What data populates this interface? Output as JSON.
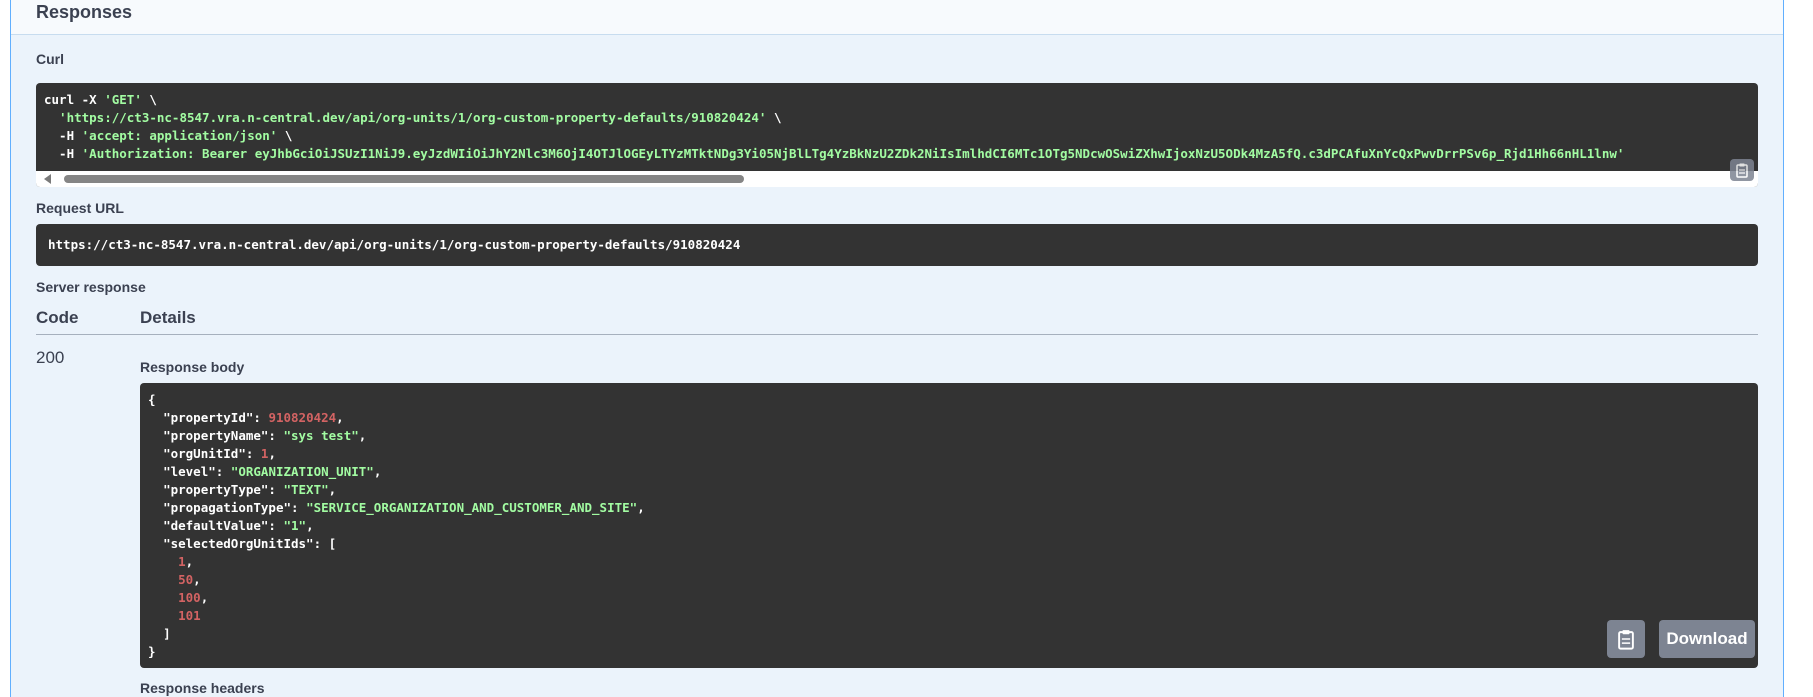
{
  "responses": {
    "title": "Responses",
    "curl_label": "Curl",
    "curl": {
      "l1_cmd": "curl -X ",
      "l1_method": "'GET'",
      "l1_cont": " \\",
      "l2_url": "  'https://ct3-nc-8547.vra.n-central.dev/api/org-units/1/org-custom-property-defaults/910820424'",
      "l2_cont": " \\",
      "l3_flag": "  -H ",
      "l3_val": "'accept: application/json'",
      "l3_cont": " \\",
      "l4_flag": "  -H ",
      "l4_val": "'Authorization: Bearer eyJhbGciOiJSUzI1NiJ9.eyJzdWIiOiJhY2Nlc3M6OjI4OTJlOGEyLTYzMTktNDg3Yi05NjBlLTg4YzBkNzU2ZDk2NiIsImlhdCI6MTc1OTg5NDcwOSwiZXhwIjoxNzU5ODk4MzA5fQ.c3dPCAfuXnYcQxPwvDrrPSv6p_Rjd1Hh66nHL1lnw'"
    },
    "request_url_label": "Request URL",
    "request_url": "https://ct3-nc-8547.vra.n-central.dev/api/org-units/1/org-custom-property-defaults/910820424",
    "server_response_label": "Server response",
    "table": {
      "code_header": "Code",
      "details_header": "Details",
      "code": "200"
    },
    "response_body_label": "Response body",
    "response_headers_label": "Response headers",
    "download_label": "Download",
    "body": {
      "open": "{",
      "k1": "\"propertyId\"",
      "v1": "910820424",
      "k2": "\"propertyName\"",
      "v2": "\"sys test\"",
      "k3": "\"orgUnitId\"",
      "v3": "1",
      "k4": "\"level\"",
      "v4": "\"ORGANIZATION_UNIT\"",
      "k5": "\"propertyType\"",
      "v5": "\"TEXT\"",
      "k6": "\"propagationType\"",
      "v6": "\"SERVICE_ORGANIZATION_AND_CUSTOMER_AND_SITE\"",
      "k7": "\"defaultValue\"",
      "v7": "\"1\"",
      "k8": "\"selectedOrgUnitIds\"",
      "v8": "[",
      "a1": "1",
      "a2": "50",
      "a3": "100",
      "a4": "101",
      "arr_close": "]",
      "close": "}"
    }
  },
  "colors": {
    "panel_bg": "#ebf3fb",
    "panel_border": "#61affe",
    "code_bg": "#333333",
    "string": "#a2fca2",
    "number": "#d36363",
    "button_bg": "#7d8492"
  },
  "icons": [
    "copy-icon",
    "scroll-left-icon"
  ]
}
